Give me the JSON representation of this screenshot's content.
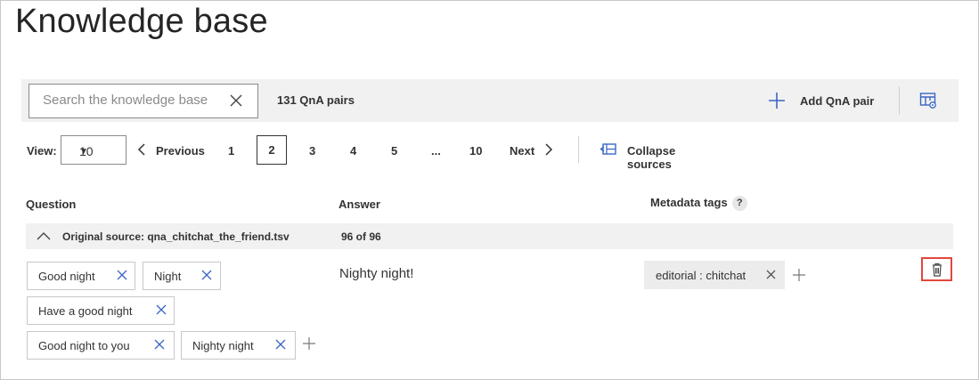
{
  "page": {
    "title": "Knowledge base"
  },
  "toolbar": {
    "search_placeholder": "Search the knowledge base",
    "pairs_count": "131 QnA pairs",
    "add_pair_label": "Add QnA pair"
  },
  "pager": {
    "view_label": "View:",
    "view_value": "10",
    "previous_label": "Previous",
    "pages": [
      "1",
      "2",
      "3",
      "4",
      "5",
      "...",
      "10"
    ],
    "current_page": "2",
    "next_label": "Next",
    "collapse_label": "Collapse sources"
  },
  "columns": {
    "question": "Question",
    "answer": "Answer",
    "metadata": "Metadata tags",
    "help": "?"
  },
  "source": {
    "label": "Original source: qna_chitchat_the_friend.tsv",
    "count": "96 of 96"
  },
  "row": {
    "questions": [
      "Good night",
      "Night",
      "Have a good night",
      "Good night to you",
      "Nighty night"
    ],
    "answer": "Nighty night!",
    "metadata": [
      "editorial : chitchat"
    ]
  },
  "colors": {
    "accent": "#3a66c4",
    "delete_highlight": "#e2473c",
    "toolbar_bg": "#f1f1f1"
  },
  "icons": {
    "clear": "close-icon",
    "add": "plus-icon",
    "table": "table-settings-icon",
    "collapse": "collapse-sources-icon",
    "delete": "trash-icon"
  }
}
